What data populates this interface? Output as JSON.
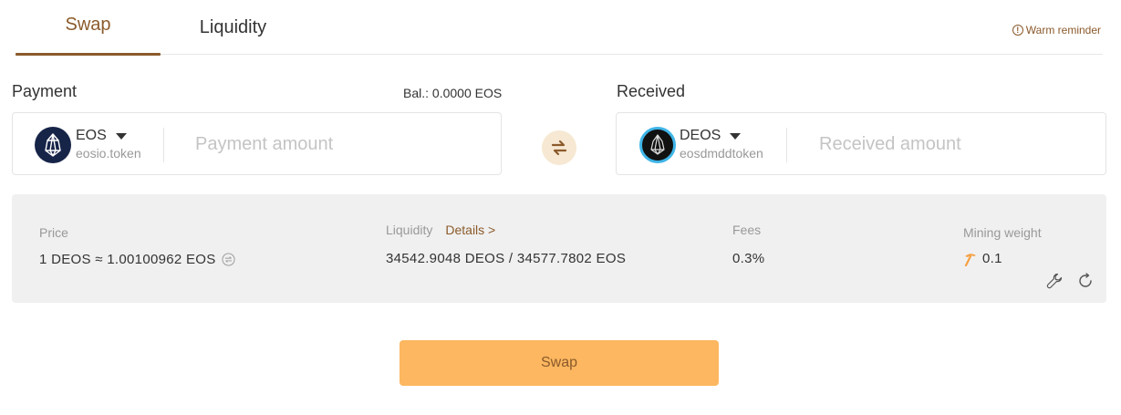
{
  "tabs": {
    "swap": "Swap",
    "liquidity": "Liquidity"
  },
  "reminder": {
    "icon": "info-icon",
    "label": "Warm reminder"
  },
  "payment": {
    "label": "Payment",
    "balance": "Bal.: 0.0000 EOS",
    "token": {
      "symbol": "EOS",
      "contract": "eosio.token",
      "logo": "eos-logo-icon",
      "logo_color": "#162448"
    },
    "amount_placeholder": "Payment amount"
  },
  "received": {
    "label": "Received",
    "token": {
      "symbol": "DEOS",
      "contract": "eosdmddtoken",
      "logo": "deos-logo-icon",
      "logo_color": "#111111",
      "ring_color": "#3fb5e8"
    },
    "amount_placeholder": "Received amount"
  },
  "info": {
    "price_label": "Price",
    "price_value": "1 DEOS ≈ 1.00100962 EOS",
    "liquidity_label": "Liquidity",
    "details_label": "Details >",
    "liquidity_value": "34542.9048 DEOS / 34577.7802 EOS",
    "fees_label": "Fees",
    "fees_value": "0.3%",
    "mining_label": "Mining weight",
    "mining_value": "0.1"
  },
  "colors": {
    "accent": "#8b5a2b",
    "button": "#fcb760",
    "mining": "#f5a043",
    "panel": "#f0f0f0"
  },
  "swap_button": "Swap"
}
